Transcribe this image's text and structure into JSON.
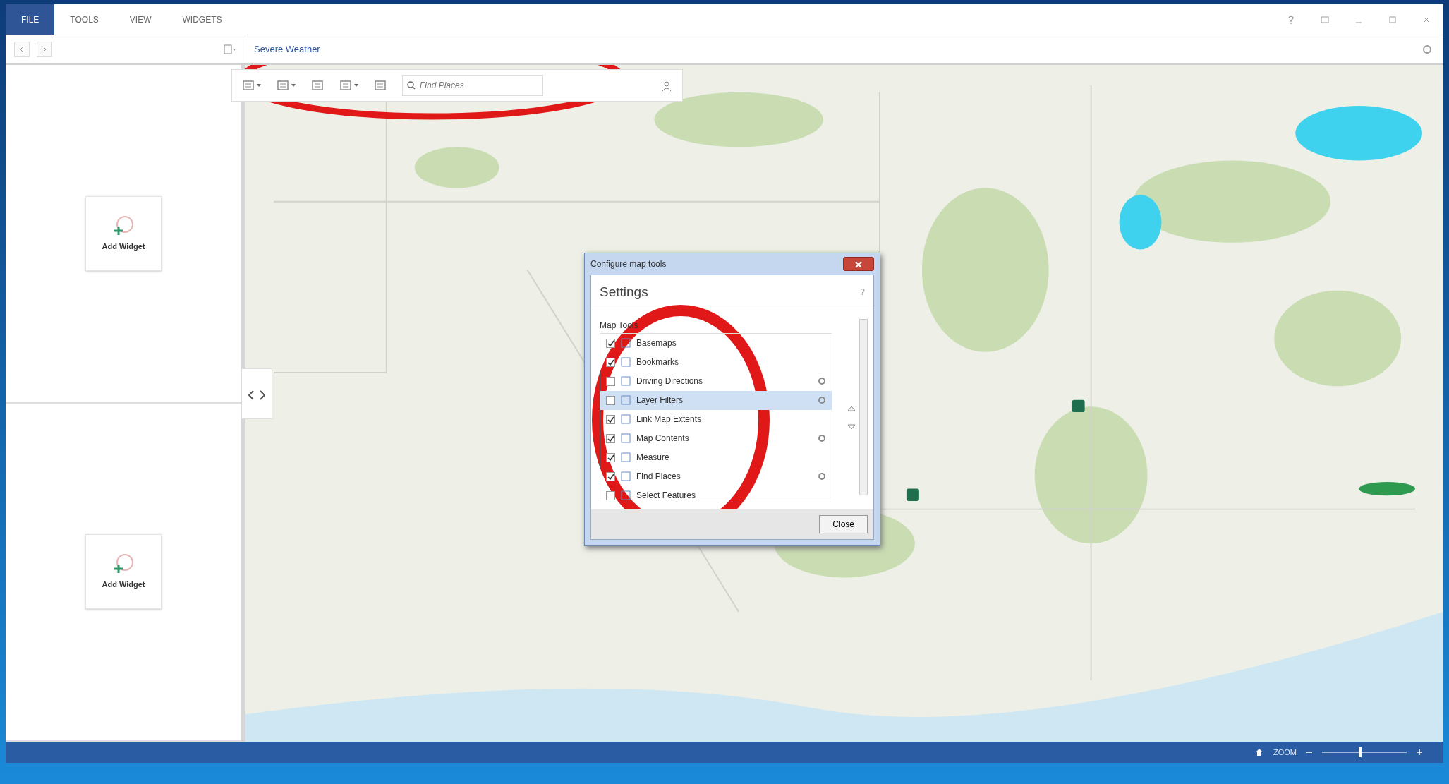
{
  "ribbon": {
    "tabs": [
      {
        "label": "FILE",
        "selected": true
      },
      {
        "label": "TOOLS",
        "selected": false
      },
      {
        "label": "VIEW",
        "selected": false
      },
      {
        "label": "WIDGETS",
        "selected": false
      }
    ]
  },
  "dashboard": {
    "title": "Severe Weather"
  },
  "widget_panel": {
    "slots": [
      {
        "label": "Add Widget"
      },
      {
        "label": "Add Widget"
      }
    ]
  },
  "map_toolbar": {
    "search": {
      "placeholder": "Find Places"
    }
  },
  "dialog": {
    "title": "Configure map tools",
    "heading": "Settings",
    "help": "?",
    "section": "Map Tools",
    "tools": [
      {
        "label": "Basemaps",
        "checked": true,
        "settings": false,
        "selected": false
      },
      {
        "label": "Bookmarks",
        "checked": true,
        "settings": false,
        "selected": false
      },
      {
        "label": "Driving Directions",
        "checked": false,
        "settings": true,
        "selected": false
      },
      {
        "label": "Layer Filters",
        "checked": false,
        "settings": true,
        "selected": true
      },
      {
        "label": "Link Map Extents",
        "checked": true,
        "settings": false,
        "selected": false
      },
      {
        "label": "Map Contents",
        "checked": true,
        "settings": true,
        "selected": false
      },
      {
        "label": "Measure",
        "checked": true,
        "settings": false,
        "selected": false
      },
      {
        "label": "Find Places",
        "checked": true,
        "settings": true,
        "selected": false
      },
      {
        "label": "Select Features",
        "checked": false,
        "settings": false,
        "selected": false
      }
    ],
    "close": "Close"
  },
  "status_bar": {
    "zoom_label": "ZOOM",
    "zoom": {
      "level": 0.45
    }
  }
}
